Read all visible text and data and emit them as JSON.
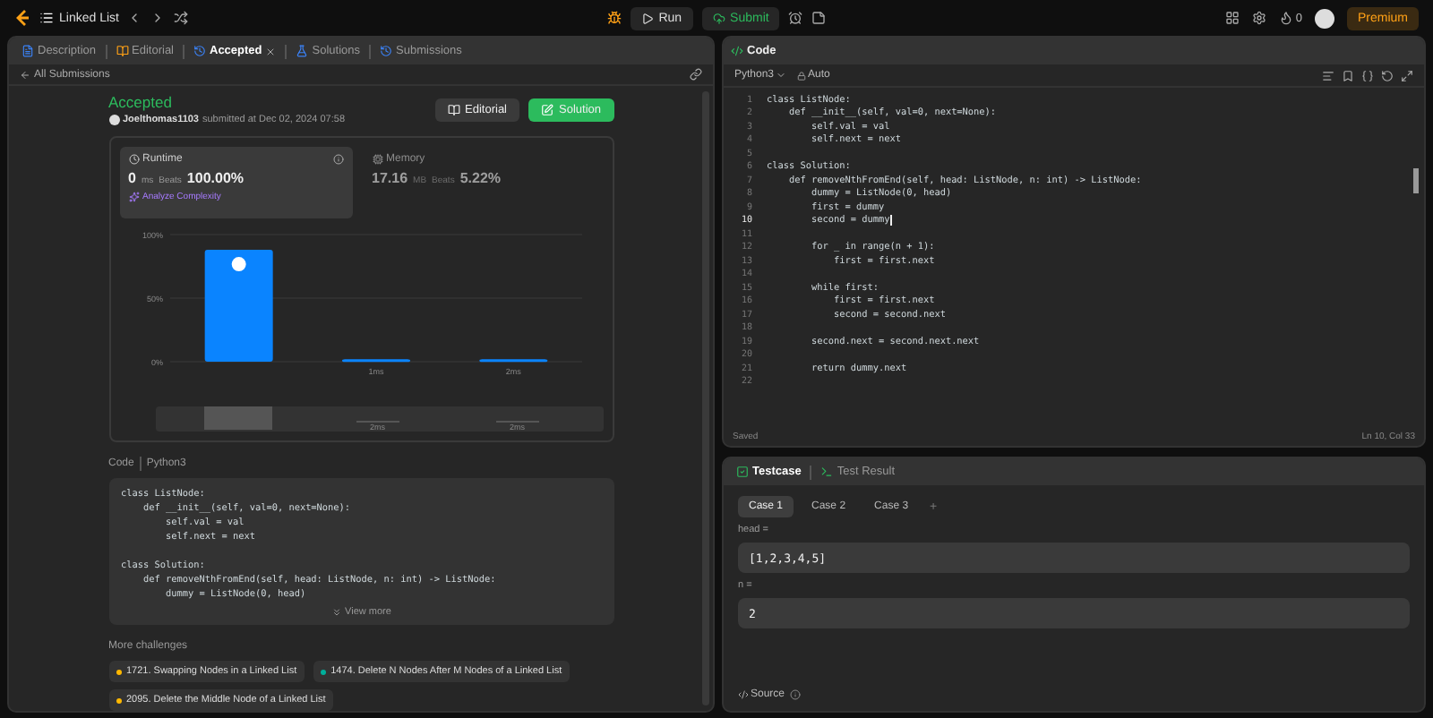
{
  "top_bar": {
    "problem_title": "Linked List",
    "run": "Run",
    "submit": "Submit",
    "streak": "0",
    "premium": "Premium"
  },
  "left_tabs": [
    {
      "label": "Description",
      "selected": false,
      "closable": false
    },
    {
      "label": "Editorial",
      "selected": false,
      "closable": false
    },
    {
      "label": "Accepted",
      "selected": true,
      "closable": true
    },
    {
      "label": "Solutions",
      "selected": false,
      "closable": false
    },
    {
      "label": "Submissions",
      "selected": false,
      "closable": false
    }
  ],
  "back_link": "All Submissions",
  "submission": {
    "status": "Accepted",
    "user": "Joelthomas1103",
    "submitted_at": "submitted at Dec 02, 2024 07:58",
    "editorial_button": "Editorial",
    "solution_button": "Solution",
    "stats": [
      {
        "kind": "runtime",
        "title": "Runtime",
        "value": "0",
        "unit": "ms",
        "beats_label": "Beats",
        "beats": "100.00%",
        "selected": true
      },
      {
        "kind": "memory",
        "title": "Memory",
        "value": "17.16",
        "unit": "MB",
        "beats_label": "Beats",
        "beats": "5.22%",
        "selected": false
      }
    ],
    "analyze": "Analyze Complexity",
    "chart_data": {
      "type": "bar",
      "categories": [
        null,
        "1ms",
        "2ms"
      ],
      "values": [
        88,
        2,
        2
      ],
      "ylim": [
        0,
        100
      ],
      "yticks": [
        {
          "value": 0,
          "label": "0%"
        },
        {
          "value": 50,
          "label": "50%"
        },
        {
          "value": 100,
          "label": "100%"
        }
      ]
    },
    "brush_labels": [
      "2ms",
      "2ms"
    ],
    "code_label": "Code",
    "code_language": "Python3",
    "code_blocks": [
      {
        "lines": [
          "class ListNode:",
          "    def __init__(self, val=0, next=None):",
          "        self.val = val",
          "        self.next = next"
        ]
      },
      {
        "lines": [
          "class Solution:",
          "    def removeNthFromEnd(self, head: ListNode, n: int) -> ListNode:",
          "        dummy = ListNode(0, head)"
        ]
      }
    ],
    "view_more": "View more"
  },
  "more_challenges": {
    "title": "More challenges",
    "items": [
      {
        "label": "1721. Swapping Nodes in a Linked List",
        "color": "#ffb800"
      },
      {
        "label": "1474. Delete N Nodes After M Nodes of a Linked List",
        "color": "#00af9b"
      },
      {
        "label": "2095. Delete the Middle Node of a Linked List",
        "color": "#ffb800"
      }
    ]
  },
  "code_panel": {
    "title": "Code",
    "language": "Python3",
    "mode": "Auto",
    "lines": [
      {
        "n": "1",
        "text": "class ListNode:",
        "current": false
      },
      {
        "n": "2",
        "text": "    def __init__(self, val=0, next=None):",
        "current": false
      },
      {
        "n": "3",
        "text": "        self.val = val",
        "current": false
      },
      {
        "n": "4",
        "text": "        self.next = next",
        "current": false
      },
      {
        "n": "5",
        "current": false
      },
      {
        "n": "6",
        "text": "class Solution:",
        "current": false
      },
      {
        "n": "7",
        "text": "    def removeNthFromEnd(self, head: ListNode, n: int) -> ListNode:",
        "current": false
      },
      {
        "n": "8",
        "text": "        dummy = ListNode(0, head)",
        "current": false
      },
      {
        "n": "9",
        "text": "        first = dummy",
        "current": false
      },
      {
        "n": "10",
        "text": "        second = dummy",
        "current": true
      },
      {
        "n": "11",
        "current": false
      },
      {
        "n": "12",
        "text": "        for _ in range(n + 1):",
        "current": false
      },
      {
        "n": "13",
        "text": "            first = first.next",
        "current": false
      },
      {
        "n": "14",
        "current": false
      },
      {
        "n": "15",
        "text": "        while first:",
        "current": false
      },
      {
        "n": "16",
        "text": "            first = first.next",
        "current": false
      },
      {
        "n": "17",
        "text": "            second = second.next",
        "current": false
      },
      {
        "n": "18",
        "current": false
      },
      {
        "n": "19",
        "text": "        second.next = second.next.next",
        "current": false
      },
      {
        "n": "20",
        "current": false
      },
      {
        "n": "21",
        "text": "        return dummy.next",
        "current": false
      },
      {
        "n": "22",
        "current": false
      }
    ],
    "saved": "Saved",
    "cursor": "Ln 10, Col 33"
  },
  "test_panel": {
    "tabs": [
      {
        "label": "Testcase",
        "selected": true
      },
      {
        "label": "Test Result",
        "selected": false
      }
    ],
    "cases": [
      {
        "label": "Case 1",
        "selected": true
      },
      {
        "label": "Case 2",
        "selected": false
      },
      {
        "label": "Case 3",
        "selected": false
      }
    ],
    "add": "+",
    "inputs": [
      {
        "label": "head =",
        "value": "[1,2,3,4,5]"
      },
      {
        "label": "n =",
        "value": "2"
      }
    ],
    "source": "Source"
  }
}
